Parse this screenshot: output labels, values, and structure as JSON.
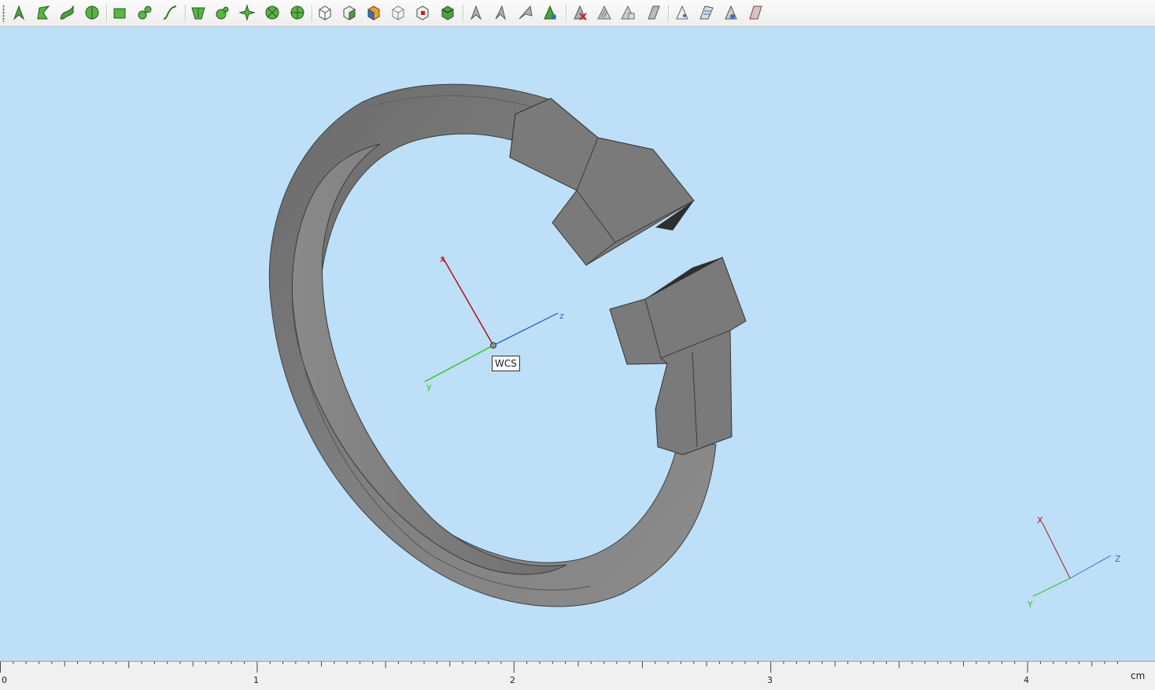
{
  "toolbar": {
    "buttons": [
      {
        "name": "pick-point-tool",
        "icon": "pick-point-icon"
      },
      {
        "name": "pick-edge-tool",
        "icon": "pick-edge-icon"
      },
      {
        "name": "pick-curve-tool",
        "icon": "pick-curve-icon"
      },
      {
        "name": "pick-circle-tool",
        "icon": "pick-circle-icon"
      },
      {
        "name": "pick-face-tool",
        "icon": "pick-face-icon"
      },
      {
        "name": "pick-face-center-tool",
        "icon": "pick-face-center-icon"
      },
      {
        "name": "pick-spline-tool",
        "icon": "pick-spline-icon"
      },
      {
        "name": "face-normal-tool",
        "icon": "face-normal-icon"
      },
      {
        "name": "face-radius-tool",
        "icon": "face-radius-icon"
      },
      {
        "name": "face-star-tool",
        "icon": "face-star-icon"
      },
      {
        "name": "circle-center-tool",
        "icon": "circle-center-icon"
      },
      {
        "name": "circle-point-tool",
        "icon": "circle-point-icon"
      },
      {
        "name": "cube-select-tool",
        "icon": "cube-select-icon"
      },
      {
        "name": "cube-face-tool",
        "icon": "cube-face-icon"
      },
      {
        "name": "cube-color-tool",
        "icon": "cube-color-icon"
      },
      {
        "name": "cube-wire-tool",
        "icon": "cube-wire-icon"
      },
      {
        "name": "cube-red-tool",
        "icon": "cube-red-icon"
      },
      {
        "name": "cube-green-tool",
        "icon": "cube-green-icon"
      },
      {
        "name": "pick-vertex-tool",
        "icon": "pick-vertex-icon"
      },
      {
        "name": "pick-edge-mid-tool",
        "icon": "pick-edge-mid-icon"
      },
      {
        "name": "pick-edge-end-tool",
        "icon": "pick-edge-end-icon"
      },
      {
        "name": "pick-plus-tool",
        "icon": "pick-plus-icon"
      },
      {
        "name": "delete-picked-tool",
        "icon": "delete-picked-icon"
      },
      {
        "name": "hatch-tool",
        "icon": "hatch-icon"
      },
      {
        "name": "hatch-copy-tool",
        "icon": "hatch-copy-icon"
      },
      {
        "name": "plane-tool",
        "icon": "plane-icon"
      },
      {
        "name": "view-tool",
        "icon": "view-icon"
      },
      {
        "name": "view-stack-tool",
        "icon": "view-stack-icon"
      },
      {
        "name": "view-point-tool",
        "icon": "view-point-icon"
      },
      {
        "name": "view-plane-tool",
        "icon": "view-plane-icon"
      }
    ]
  },
  "viewport": {
    "background": "#bddff8",
    "model_color": "#7b7b7b",
    "wcs_label": "WCS",
    "wcs_axes": {
      "x": "x",
      "y": "y",
      "z": "z"
    },
    "orient_axes": {
      "x": "X",
      "y": "Y",
      "z": "Z"
    },
    "axis_colors": {
      "x": "#b81010",
      "y": "#3fbf1f",
      "z": "#3670c8"
    }
  },
  "ruler": {
    "labels": [
      "0",
      "1",
      "2",
      "3",
      "4"
    ],
    "unit": "cm"
  }
}
